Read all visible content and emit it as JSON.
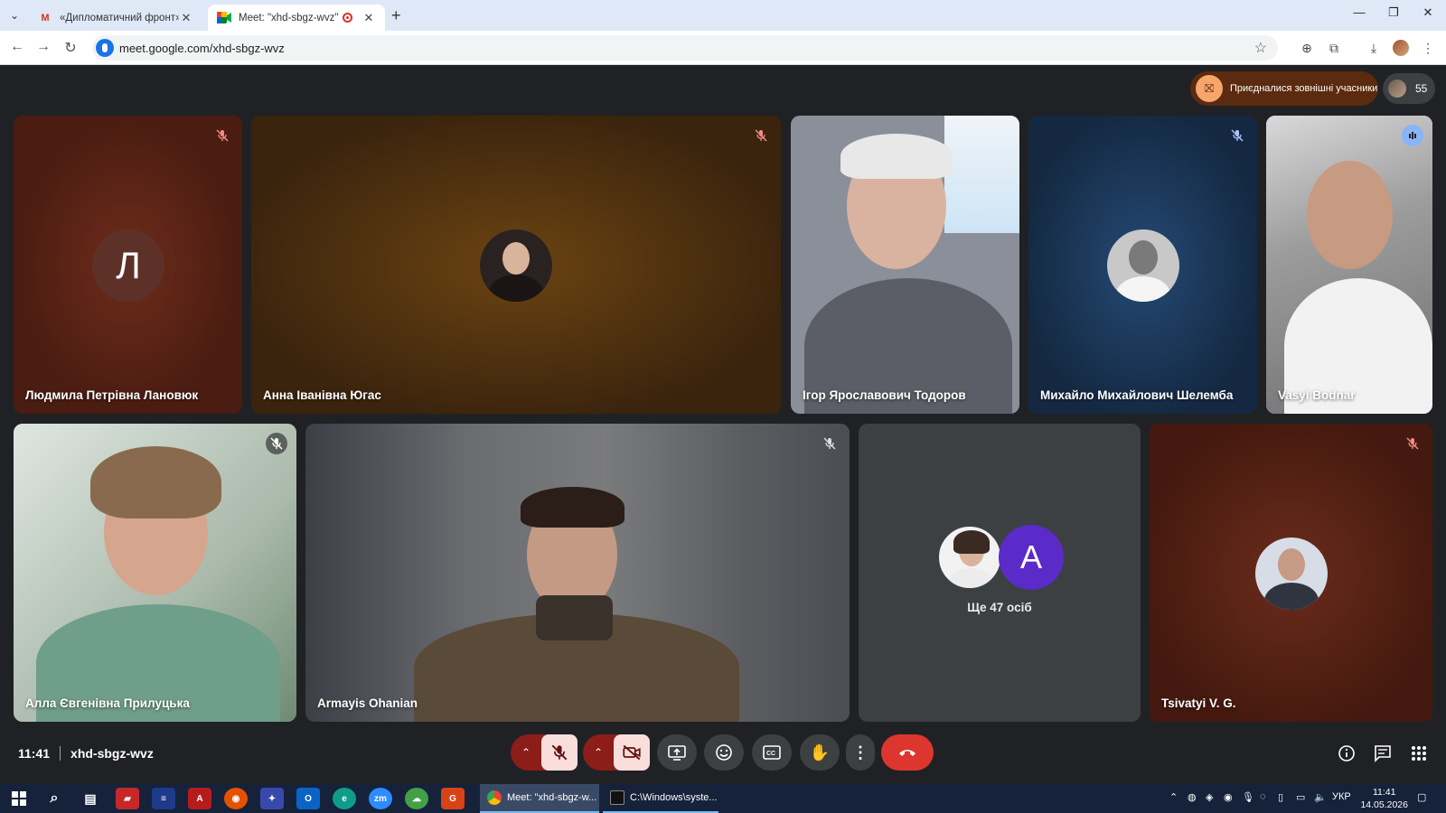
{
  "browser": {
    "tabs": [
      {
        "title": "«Дипломатичний фронт»ua - G",
        "favicon": "gmail-icon",
        "active": false
      },
      {
        "title": "Meet: \"xhd-sbgz-wvz\"",
        "favicon": "google-meet-icon",
        "active": true
      }
    ],
    "url": "meet.google.com/xhd-sbgz-wvz"
  },
  "meet": {
    "external_banner": "Приєдналися зовнішні учасники",
    "participant_count": "55",
    "tiles": [
      {
        "name": "Людмила Петрівна Лановюк",
        "avatar_letter": "Л",
        "muted": true
      },
      {
        "name": "Анна Іванівна Югас",
        "muted": true
      },
      {
        "name": "Ігор Ярославович Тодоров",
        "muted": false
      },
      {
        "name": "Михайло Михайлович Шелемба",
        "muted": true
      },
      {
        "name": "Vasyl Bodnar",
        "speaking": true
      },
      {
        "name": "Алла Євгенівна Прилуцька",
        "muted": true
      },
      {
        "name": "Armayis Ohanian",
        "muted": true
      },
      {
        "name": "Tsivatyi V. G.",
        "muted": true
      }
    ],
    "more_tile": {
      "label": "Ще 47 осіб",
      "avatar_letter": "A"
    },
    "time": "11:41",
    "meeting_code": "xhd-sbgz-wvz",
    "colors": {
      "hangup": "#dc362e",
      "muted_control_bg": "#f9dedc",
      "speaking_outline": "#a8c7fa"
    }
  },
  "taskbar": {
    "windows": [
      {
        "label": "Meet: \"xhd-sbgz-w...",
        "active": true
      },
      {
        "label": "C:\\Windows\\syste...",
        "active": false
      }
    ],
    "language": "УКР",
    "clock_time": "11:41",
    "clock_date": "14.05.2026",
    "pinned_apps": [
      "zm"
    ]
  }
}
